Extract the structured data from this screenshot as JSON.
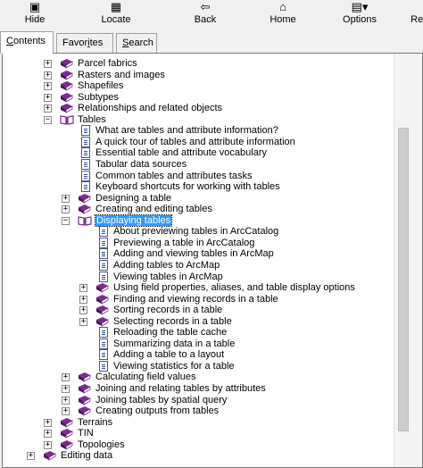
{
  "toolbar": {
    "buttons": [
      {
        "name": "hide-button",
        "icon": "hide-icon",
        "glyph": "▣",
        "label": "Hide"
      },
      {
        "name": "locate-button",
        "icon": "locate-icon",
        "glyph": "▦",
        "label": "Locate"
      },
      {
        "name": "back-button",
        "icon": "back-arrow-icon",
        "glyph": "⇦",
        "label": "Back"
      },
      {
        "name": "home-button",
        "icon": "home-icon",
        "glyph": "⌂",
        "label": "Home"
      },
      {
        "name": "options-button",
        "icon": "options-icon",
        "glyph": "▤▾",
        "label": "Options",
        "underline": "O"
      },
      {
        "name": "resources-button",
        "icon": "resources-icon",
        "glyph": "",
        "label": "Reso"
      }
    ]
  },
  "tabs": [
    {
      "name": "tab-contents",
      "label": "Contents",
      "underline": "C",
      "active": true
    },
    {
      "name": "tab-favorites",
      "label": "Favorites",
      "underline": "i",
      "active": false
    },
    {
      "name": "tab-search",
      "label": "Search",
      "underline": "S",
      "active": false
    }
  ],
  "colors": {
    "book": "#7b2d8b",
    "selection": "#3399ff"
  },
  "tree": [
    {
      "depth": 2,
      "exp": "+",
      "type": "book",
      "label": "Parcel fabrics"
    },
    {
      "depth": 2,
      "exp": "+",
      "type": "book",
      "label": "Rasters and images"
    },
    {
      "depth": 2,
      "exp": "+",
      "type": "book",
      "label": "Shapefiles"
    },
    {
      "depth": 2,
      "exp": "+",
      "type": "book",
      "label": "Subtypes"
    },
    {
      "depth": 2,
      "exp": "+",
      "type": "book",
      "label": "Relationships and related objects"
    },
    {
      "depth": 2,
      "exp": "−",
      "type": "book-open",
      "label": "Tables"
    },
    {
      "depth": 3,
      "exp": "",
      "type": "page",
      "label": "What are tables and attribute information?"
    },
    {
      "depth": 3,
      "exp": "",
      "type": "page",
      "label": "A quick tour of tables and attribute information"
    },
    {
      "depth": 3,
      "exp": "",
      "type": "page",
      "label": "Essential table and attribute vocabulary"
    },
    {
      "depth": 3,
      "exp": "",
      "type": "page",
      "label": "Tabular data sources"
    },
    {
      "depth": 3,
      "exp": "",
      "type": "page",
      "label": "Common tables and attributes tasks"
    },
    {
      "depth": 3,
      "exp": "",
      "type": "page",
      "label": "Keyboard shortcuts for working with tables"
    },
    {
      "depth": 3,
      "exp": "+",
      "type": "book",
      "label": "Designing a table"
    },
    {
      "depth": 3,
      "exp": "+",
      "type": "book",
      "label": "Creating and editing tables"
    },
    {
      "depth": 3,
      "exp": "−",
      "type": "book-open",
      "label": "Displaying tables",
      "selected": true
    },
    {
      "depth": 4,
      "exp": "",
      "type": "page",
      "label": "About previewing tables in ArcCatalog"
    },
    {
      "depth": 4,
      "exp": "",
      "type": "page",
      "label": "Previewing a table in ArcCatalog"
    },
    {
      "depth": 4,
      "exp": "",
      "type": "page",
      "label": "Adding and viewing tables in ArcMap"
    },
    {
      "depth": 4,
      "exp": "",
      "type": "page",
      "label": "Adding tables to ArcMap"
    },
    {
      "depth": 4,
      "exp": "",
      "type": "page",
      "label": "Viewing tables in ArcMap"
    },
    {
      "depth": 4,
      "exp": "+",
      "type": "book",
      "label": "Using field properties, aliases, and table display options"
    },
    {
      "depth": 4,
      "exp": "+",
      "type": "book",
      "label": "Finding and viewing records in a table"
    },
    {
      "depth": 4,
      "exp": "+",
      "type": "book",
      "label": "Sorting records in a table"
    },
    {
      "depth": 4,
      "exp": "+",
      "type": "book",
      "label": "Selecting records in a table"
    },
    {
      "depth": 4,
      "exp": "",
      "type": "page",
      "label": "Reloading the table cache"
    },
    {
      "depth": 4,
      "exp": "",
      "type": "page",
      "label": "Summarizing data in a table"
    },
    {
      "depth": 4,
      "exp": "",
      "type": "page",
      "label": "Adding a table to a layout"
    },
    {
      "depth": 4,
      "exp": "",
      "type": "page",
      "label": "Viewing statistics for a table"
    },
    {
      "depth": 3,
      "exp": "+",
      "type": "book",
      "label": "Calculating field values"
    },
    {
      "depth": 3,
      "exp": "+",
      "type": "book",
      "label": "Joining and relating tables by attributes"
    },
    {
      "depth": 3,
      "exp": "+",
      "type": "book",
      "label": "Joining tables by spatial query"
    },
    {
      "depth": 3,
      "exp": "+",
      "type": "book",
      "label": "Creating outputs from tables"
    },
    {
      "depth": 2,
      "exp": "+",
      "type": "book",
      "label": "Terrains"
    },
    {
      "depth": 2,
      "exp": "+",
      "type": "book",
      "label": "TIN"
    },
    {
      "depth": 2,
      "exp": "+",
      "type": "book",
      "label": "Topologies"
    },
    {
      "depth": 1,
      "exp": "+",
      "type": "book",
      "label": "Editing data"
    }
  ]
}
